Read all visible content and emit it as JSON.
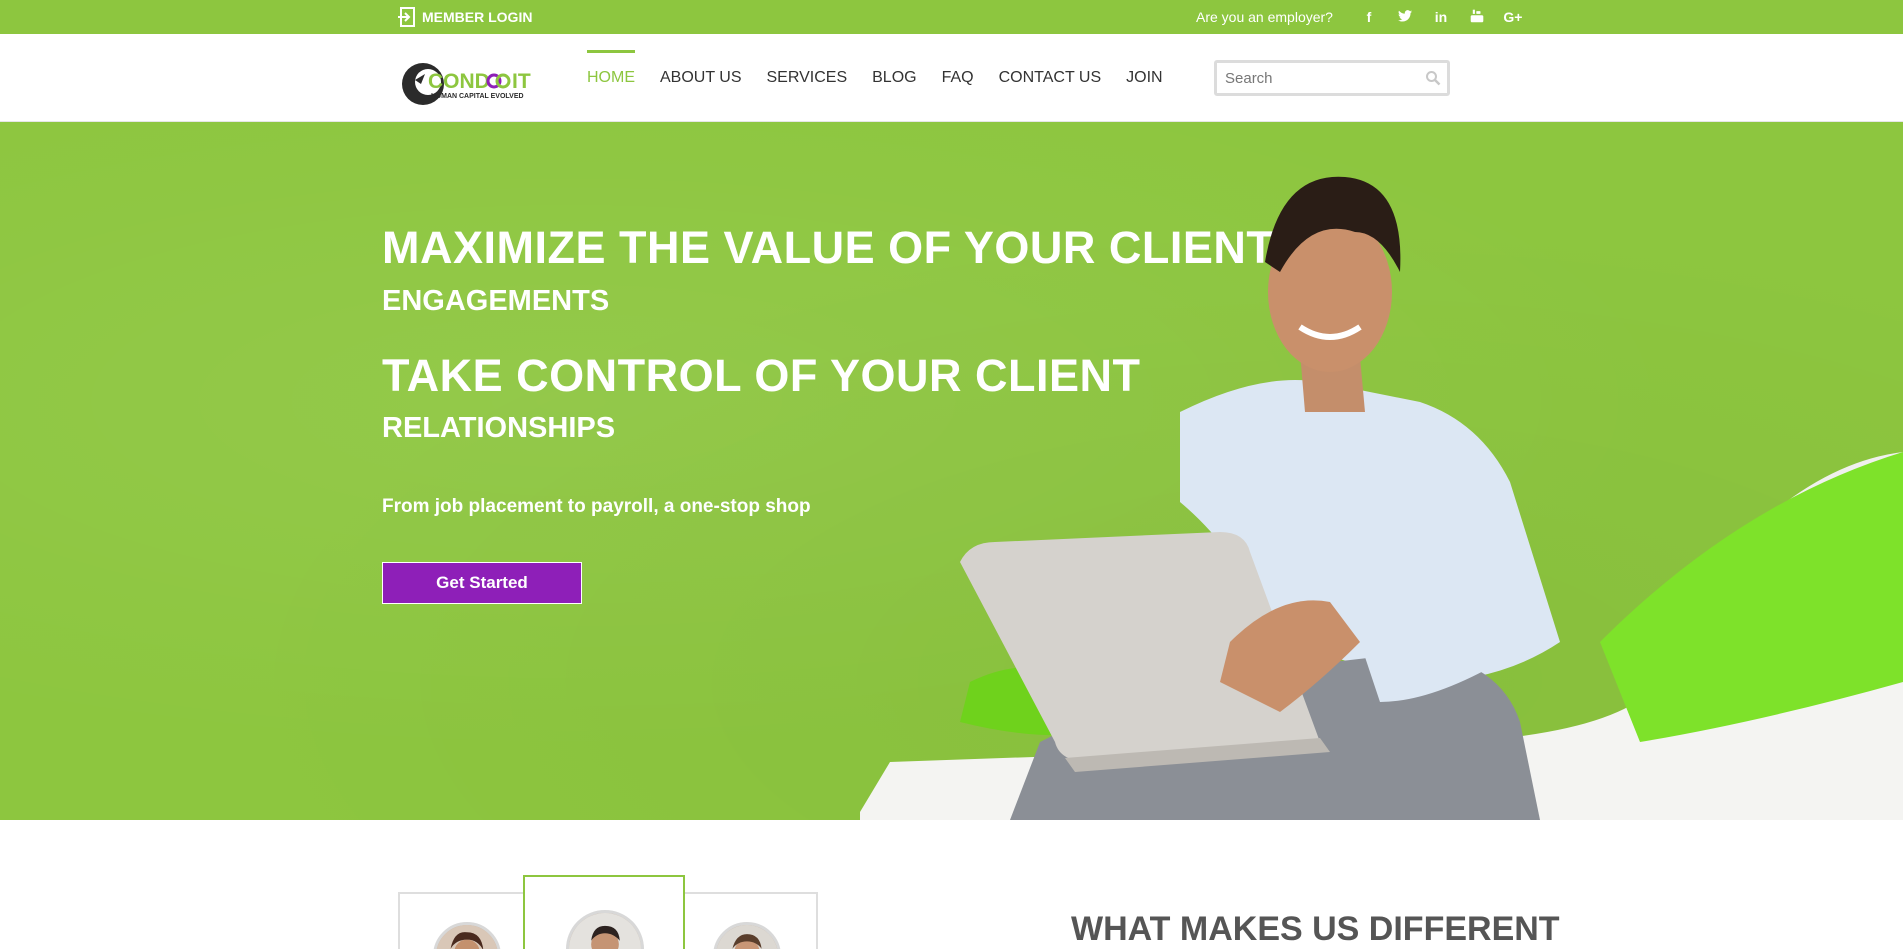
{
  "topbar": {
    "member_login": "MEMBER LOGIN",
    "employer_link": "Are you an employer?",
    "social": [
      {
        "icon": "facebook-icon",
        "glyph": "f"
      },
      {
        "icon": "twitter-icon",
        "glyph": "🐦"
      },
      {
        "icon": "linkedin-icon",
        "glyph": "in"
      },
      {
        "icon": "youtube-icon",
        "glyph": "▶"
      },
      {
        "icon": "google-plus-icon",
        "glyph": "G+"
      }
    ]
  },
  "header": {
    "logo_text": "CONDOIT",
    "logo_tagline": "HUMAN CAPITAL EVOLVED",
    "nav": [
      {
        "label": "HOME",
        "active": true
      },
      {
        "label": "ABOUT US",
        "active": false
      },
      {
        "label": "SERVICES",
        "active": false
      },
      {
        "label": "BLOG",
        "active": false
      },
      {
        "label": "FAQ",
        "active": false
      },
      {
        "label": "CONTACT US",
        "active": false
      },
      {
        "label": "JOIN",
        "active": false
      }
    ],
    "search_placeholder": "Search"
  },
  "hero": {
    "line1": "MAXIMIZE THE VALUE OF YOUR CLIENT",
    "line2": "ENGAGEMENTS",
    "line3": "TAKE CONTROL OF YOUR CLIENT",
    "line4": "RELATIONSHIPS",
    "subtitle": "From job placement to payroll, a one-stop shop",
    "cta_label": "Get Started"
  },
  "section": {
    "title": "WHAT MAKES US DIFFERENT"
  },
  "colors": {
    "brand_green": "#8dc63f",
    "cta_purple": "#8e1fb8",
    "logo_purple": "#8e1fb8"
  }
}
